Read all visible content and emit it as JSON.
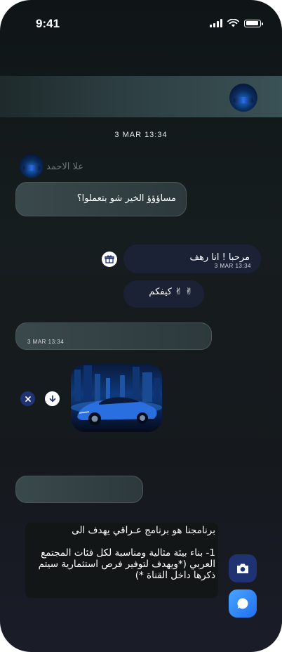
{
  "status_bar": {
    "time": "9:41"
  },
  "header": {
    "avatar_icon": "car-avatar"
  },
  "chat": {
    "date_separator": "3 MAR 13:34",
    "sender_name": "علا الاحمد",
    "messages": [
      {
        "direction": "received",
        "text": "مساؤؤؤ الخير شو بتعملوا؟"
      },
      {
        "direction": "sent",
        "text": "مرحبا ! انا رهف",
        "timestamp": "3 MAR 13:34"
      },
      {
        "direction": "sent",
        "text": "✌ ✌ كيفكم"
      },
      {
        "direction": "received",
        "text": "",
        "timestamp": "3 MAR 13:34"
      },
      {
        "direction": "received",
        "type": "image",
        "image_icon": "sports-car-image"
      },
      {
        "direction": "received",
        "text": ""
      }
    ]
  },
  "composer": {
    "text": "برنامجنا هو برنامج عـراقي يهدف الى\n\n1- بناء بيئة مثالية ومناسبة لكل فئات المجتمع العربي (*ويهدف لتوفير فرص استثمارية سيتم ذكرها داخل القناة *)"
  },
  "icons": {
    "gift": "gift-icon",
    "close": "close-icon",
    "download": "download-icon",
    "camera": "camera-icon",
    "chat": "chat-icon"
  },
  "colors": {
    "sent_bubble": "#1b2236",
    "received_bubble": "#3a494c",
    "accent": "#1f6ff0",
    "dark_button": "#1f3272"
  }
}
